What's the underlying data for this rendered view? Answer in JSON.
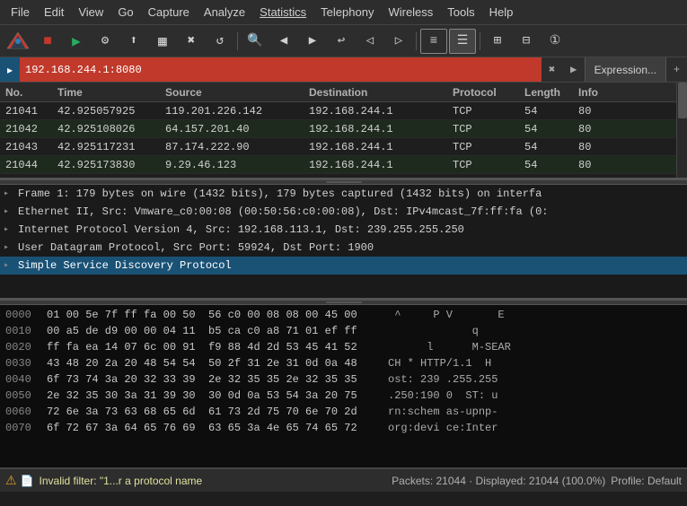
{
  "menubar": {
    "items": [
      {
        "label": "File",
        "id": "file"
      },
      {
        "label": "Edit",
        "id": "edit"
      },
      {
        "label": "View",
        "id": "view"
      },
      {
        "label": "Go",
        "id": "go"
      },
      {
        "label": "Capture",
        "id": "capture"
      },
      {
        "label": "Analyze",
        "id": "analyze"
      },
      {
        "label": "Statistics",
        "id": "statistics"
      },
      {
        "label": "Telephony",
        "id": "telephony"
      },
      {
        "label": "Wireless",
        "id": "wireless"
      },
      {
        "label": "Tools",
        "id": "tools"
      },
      {
        "label": "Help",
        "id": "help"
      }
    ]
  },
  "toolbar": {
    "buttons": [
      {
        "icon": "🦈",
        "name": "wireshark-logo"
      },
      {
        "icon": "⏹",
        "name": "stop-capture"
      },
      {
        "icon": "🔴",
        "name": "start-capture"
      },
      {
        "icon": "⚙",
        "name": "options"
      },
      {
        "icon": "⬆",
        "name": "open-file"
      },
      {
        "icon": "⬛",
        "name": "save-file"
      },
      {
        "icon": "✖",
        "name": "close"
      },
      {
        "icon": "🔃",
        "name": "reload"
      },
      {
        "sep": true
      },
      {
        "icon": "🔍",
        "name": "find"
      },
      {
        "icon": "◀",
        "name": "prev"
      },
      {
        "icon": "▶",
        "name": "next"
      },
      {
        "icon": "↩",
        "name": "go-back"
      },
      {
        "icon": "◁",
        "name": "go-prev"
      },
      {
        "icon": "▷",
        "name": "go-next"
      },
      {
        "sep": true
      },
      {
        "icon": "≡",
        "name": "colorize"
      },
      {
        "icon": "☰",
        "name": "auto-scroll"
      },
      {
        "sep": true
      },
      {
        "icon": "⊞",
        "name": "zoom-in"
      },
      {
        "icon": "⊟",
        "name": "zoom-out"
      },
      {
        "icon": "①",
        "name": "normal-size"
      }
    ]
  },
  "filterbar": {
    "label": "▸",
    "value": "192.168.244.1:8080",
    "expression_btn": "Expression...",
    "plus_btn": "+"
  },
  "table": {
    "headers": [
      "No.",
      "Time",
      "Source",
      "Destination",
      "Protocol",
      "Length",
      "Info"
    ],
    "rows": [
      {
        "no": "21041",
        "time": "42.925057925",
        "src": "119.201.226.142",
        "dst": "192.168.244.1",
        "proto": "TCP",
        "len": "54",
        "info": "80",
        "selected": false,
        "even": false
      },
      {
        "no": "21042",
        "time": "42.925108026",
        "src": "64.157.201.40",
        "dst": "192.168.244.1",
        "proto": "TCP",
        "len": "54",
        "info": "80",
        "selected": false,
        "even": true
      },
      {
        "no": "21043",
        "time": "42.925117231",
        "src": "87.174.222.90",
        "dst": "192.168.244.1",
        "proto": "TCP",
        "len": "54",
        "info": "80",
        "selected": false,
        "even": false
      },
      {
        "no": "21044",
        "time": "42.925173830",
        "src": "9.29.46.123",
        "dst": "192.168.244.1",
        "proto": "TCP",
        "len": "54",
        "info": "80",
        "selected": false,
        "even": true
      }
    ]
  },
  "detail": {
    "rows": [
      {
        "expand": "▸",
        "text": "Frame 1: 179 bytes on wire (1432 bits), 179 bytes captured (1432 bits) on interfa",
        "selected": false
      },
      {
        "expand": "▸",
        "text": "Ethernet II, Src: Vmware_c0:00:08 (00:50:56:c0:00:08), Dst: IPv4mcast_7f:ff:fa (0:",
        "selected": false
      },
      {
        "expand": "▸",
        "text": "Internet Protocol Version 4, Src: 192.168.113.1, Dst: 239.255.255.250",
        "selected": false
      },
      {
        "expand": "▸",
        "text": "User Datagram Protocol, Src Port: 59924, Dst Port: 1900",
        "selected": false
      },
      {
        "expand": "▸",
        "text": "Simple Service Discovery Protocol",
        "selected": true
      }
    ]
  },
  "hex": {
    "rows": [
      {
        "offset": "0000",
        "bytes": "01 00 5e 7f ff fa 00 50  56 c0 00 08 08 00 45 00",
        "ascii": " ^     P V       E "
      },
      {
        "offset": "0010",
        "bytes": "00 a5 de d9 00 00 04 11  b5 ca c0 a8 71 01 ef ff",
        "ascii": "             q     "
      },
      {
        "offset": "0020",
        "bytes": "ff fa ea 14 07 6c 00 91  f9 88 4d 2d 53 45 41 52",
        "ascii": "      l      M-SEAR"
      },
      {
        "offset": "0030",
        "bytes": "43 48 20 2a 20 48 54 54  50 2f 31 2e 31 0d 0a 48",
        "ascii": "CH * HTTP/1.1  H"
      },
      {
        "offset": "0040",
        "bytes": "6f 73 74 3a 20 32 33 39  2e 32 35 35 2e 32 35 35",
        "ascii": "ost: 239 .255.255"
      },
      {
        "offset": "0050",
        "bytes": "2e 32 35 30 3a 31 39 30  30 0d 0a 53 54 3a 20 75",
        "ascii": ".250:190 0  ST: u"
      },
      {
        "offset": "0060",
        "bytes": "72 6e 3a 73 63 68 65 6d  61 73 2d 75 70 6e 70 2d",
        "ascii": "rn:schem as-upnp-"
      },
      {
        "offset": "0070",
        "bytes": "6f 72 67 3a 64 65 76 69  63 65 3a 4e 65 74 65 72",
        "ascii": "org:devi ce:Inter"
      }
    ]
  },
  "statusbar": {
    "warning_icon": "⚠",
    "file_icon": "📄",
    "text": "Invalid filter: \"1...r a protocol name",
    "packets": "Packets: 21044 · Displayed: 21044 (100.0%)",
    "profile": "Profile: Default"
  }
}
